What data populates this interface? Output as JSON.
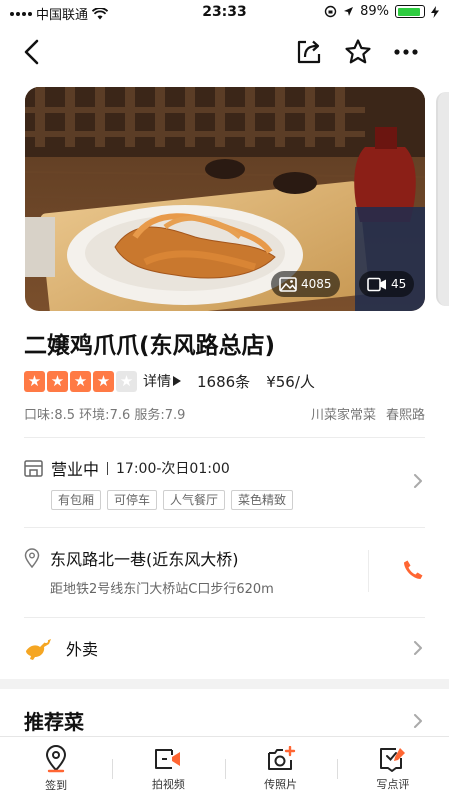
{
  "status_bar": {
    "carrier": "中国联通",
    "time": "23:33",
    "battery": "89%",
    "battery_level": 0.89
  },
  "hero": {
    "photo_count": "4085",
    "video_count": "45"
  },
  "shop": {
    "title": "二嬢鸡爪爪(东风路总店)",
    "stars_filled": 4,
    "stars_total": 5,
    "detail_label": "详情",
    "review_count": "1686条",
    "avg_price": "¥56/人",
    "scores": "口味:8.5  环境:7.6  服务:7.9",
    "category": "川菜家常菜",
    "district": "春熙路"
  },
  "hours": {
    "status": "营业中",
    "time": "17:00-次日01:00",
    "tags": [
      "有包厢",
      "可停车",
      "人气餐厅",
      "菜色精致"
    ]
  },
  "address": {
    "main": "东风路北一巷(近东风大桥)",
    "sub": "距地铁2号线东门大桥站C口步行620m"
  },
  "takeout": {
    "label": "外卖"
  },
  "recommend": {
    "title": "推荐菜"
  },
  "bottom_tabs": [
    {
      "label": "签到",
      "icon": "location-pin-icon"
    },
    {
      "label": "拍视频",
      "icon": "video-icon"
    },
    {
      "label": "传照片",
      "icon": "camera-icon"
    },
    {
      "label": "写点评",
      "icon": "write-review-icon"
    }
  ],
  "colors": {
    "accent": "#ff6633",
    "star": "#ff7a45"
  }
}
